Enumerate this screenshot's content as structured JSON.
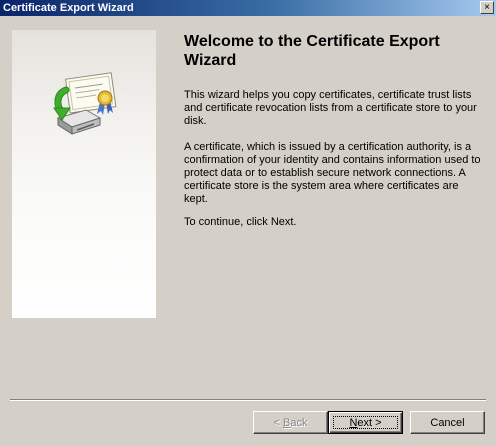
{
  "window": {
    "title": "Certificate Export Wizard",
    "close_label": "×"
  },
  "main": {
    "heading": "Welcome to the Certificate Export Wizard",
    "paragraphs": [
      "This wizard helps you copy certificates, certificate trust lists and certificate revocation lists from a certificate store to your disk.",
      "A certificate, which is issued by a certification authority, is a confirmation of your identity and contains information used to protect data or to establish secure network connections. A certificate store is the system area where certificates are kept.",
      "To continue, click Next."
    ]
  },
  "icons": {
    "wizard_graphic": "certificate-export-icon",
    "close": "close-icon"
  },
  "buttons": {
    "back": {
      "prefix": "< ",
      "accel": "B",
      "rest": "ack",
      "enabled": false
    },
    "next": {
      "accel": "N",
      "rest": "ext >",
      "enabled": true,
      "default": true
    },
    "cancel": {
      "label": "Cancel",
      "enabled": true
    }
  },
  "colors": {
    "title_start": "#0a246a",
    "title_end": "#a6caf0",
    "face": "#d4d0c8",
    "arrow_green": "#3fae2a",
    "seal_gold": "#e8b832"
  }
}
